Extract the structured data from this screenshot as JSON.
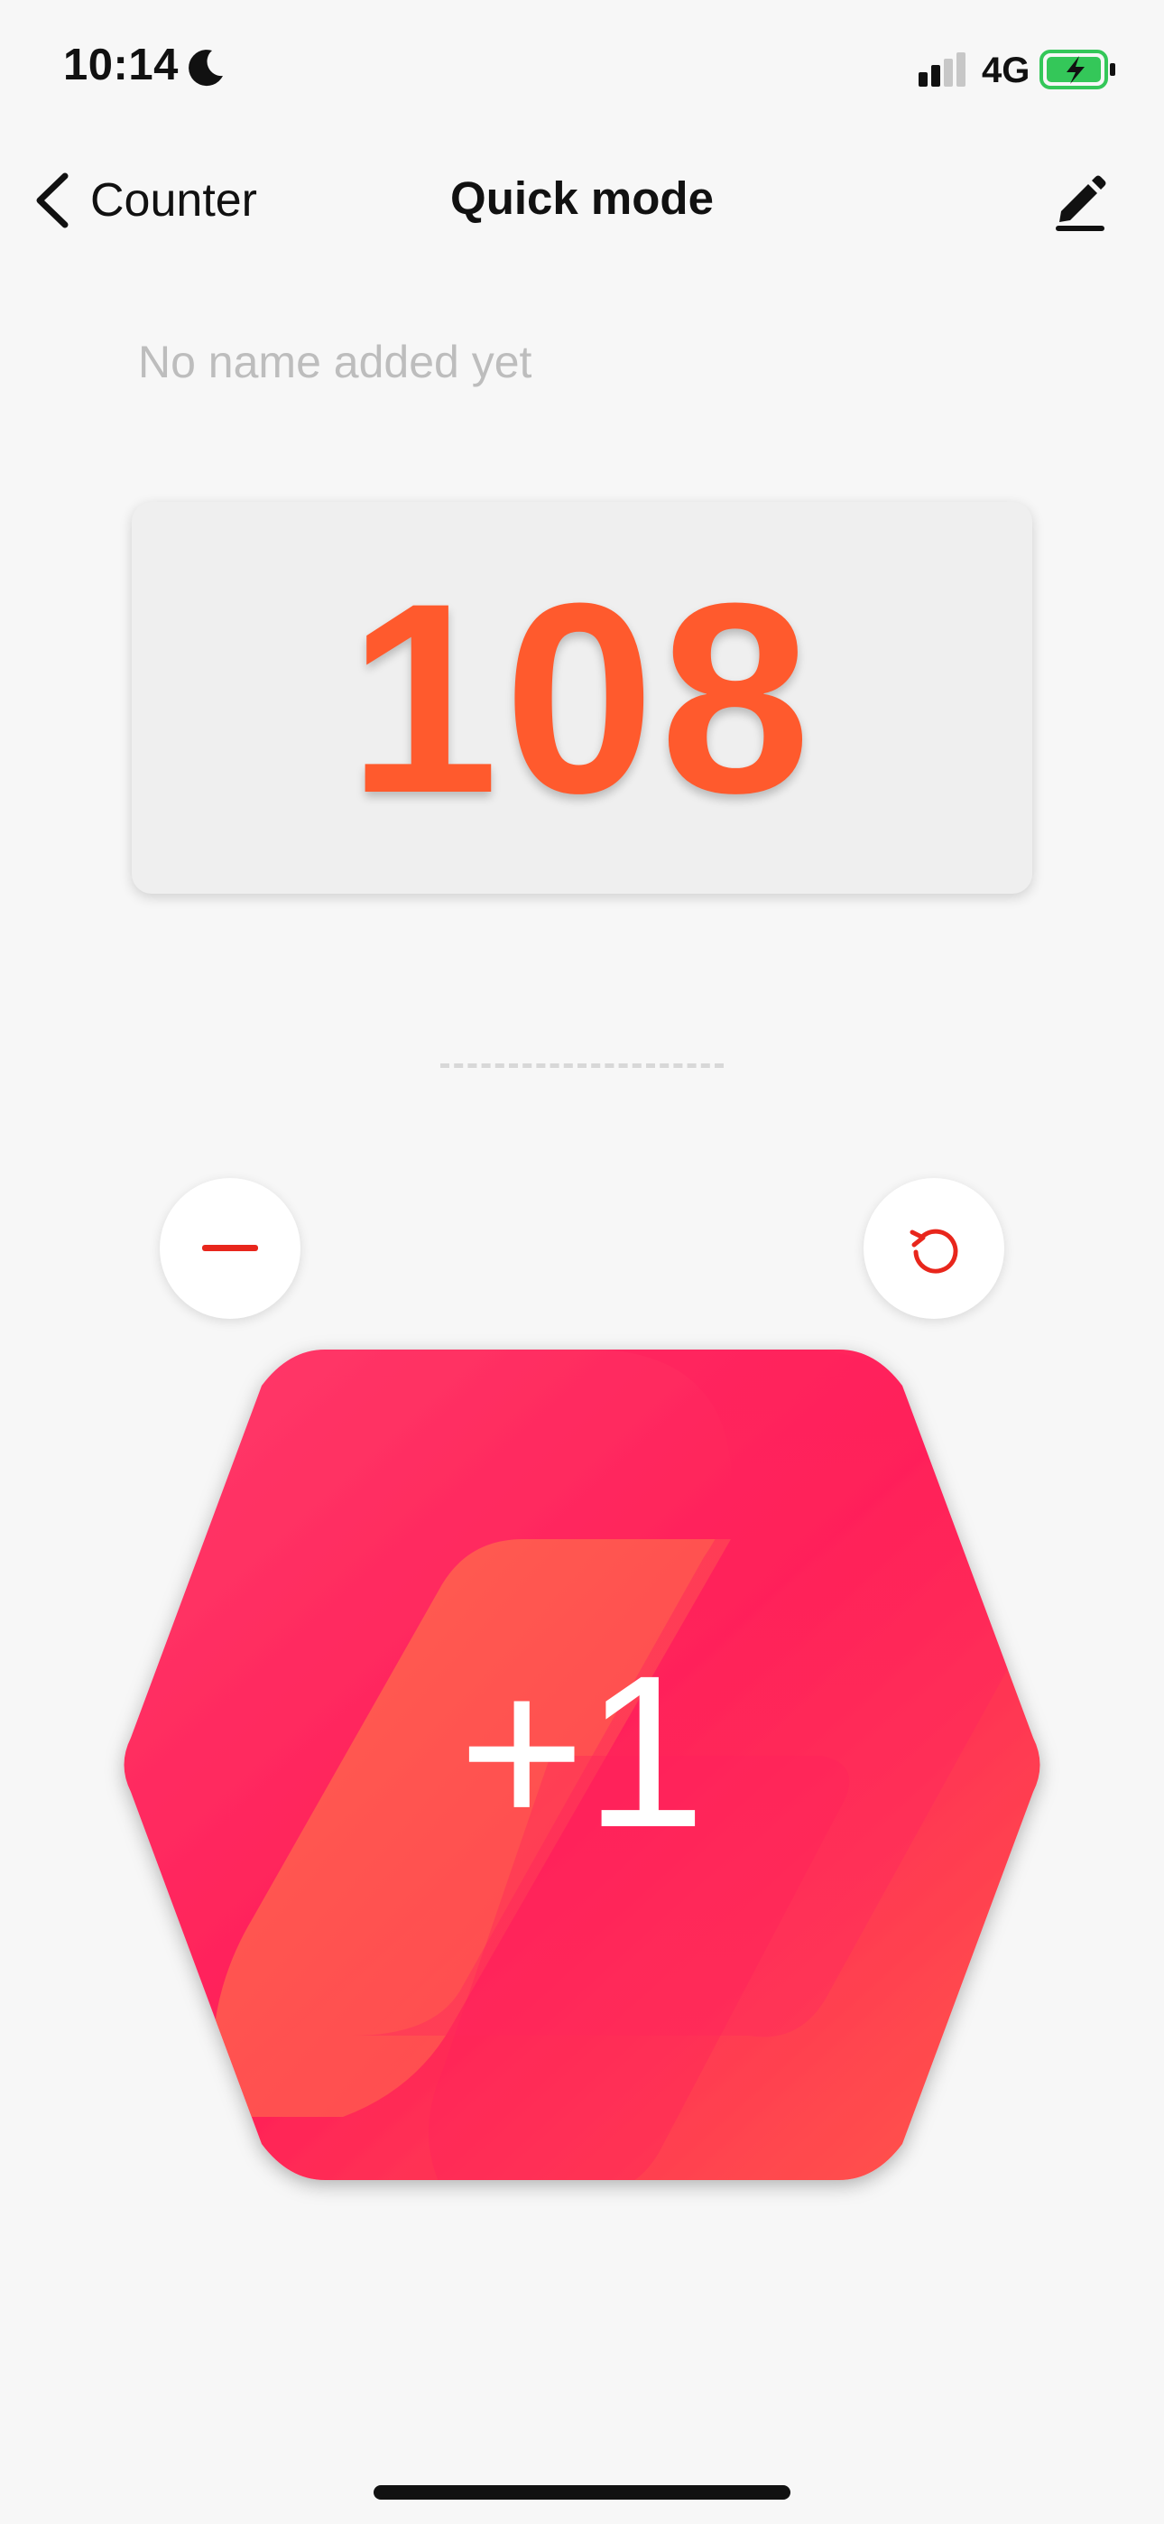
{
  "status_bar": {
    "time": "10:14",
    "network": "4G",
    "icons": [
      "moon-icon",
      "signal-icon",
      "battery-charging-icon"
    ]
  },
  "nav": {
    "back_label": "Counter",
    "title": "Quick mode",
    "icons": [
      "chevron-left-icon",
      "edit-pencil-icon"
    ]
  },
  "counter": {
    "name_placeholder": "No name added yet",
    "value": "108"
  },
  "controls": {
    "increment_label": "+1",
    "icons": [
      "minus-icon",
      "reset-icon"
    ]
  },
  "colors": {
    "count": "#ff5a2d",
    "accent": "#ff2d55",
    "minus": "#e8261c",
    "reset": "#e8261c"
  }
}
